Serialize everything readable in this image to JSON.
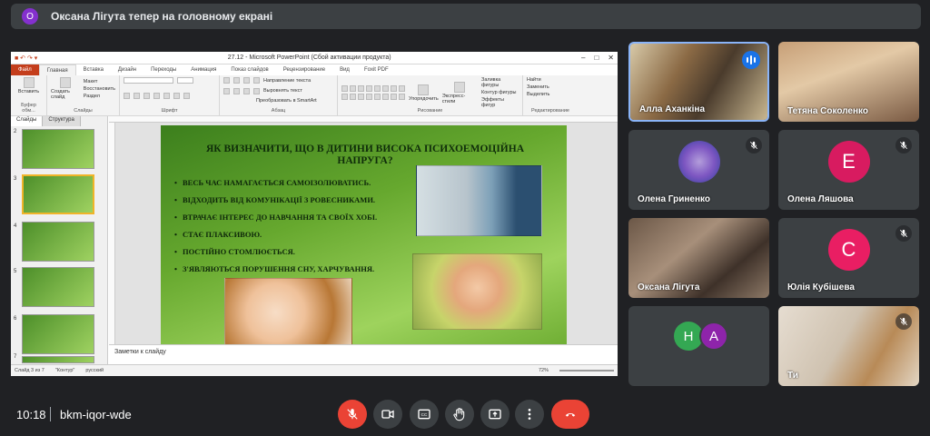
{
  "banner": {
    "avatar_letter": "О",
    "text": "Оксана Лігута тепер на головному екрані"
  },
  "powerpoint": {
    "window_title": "27.12 - Microsoft PowerPoint (Сбой активации продукта)",
    "tabs": [
      "Файл",
      "Главная",
      "Вставка",
      "Дизайн",
      "Переходы",
      "Анимация",
      "Показ слайдов",
      "Рецензирование",
      "Вид",
      "Foxit PDF"
    ],
    "active_tab": "Главная",
    "ribbon": {
      "clipboard_label": "Буфер обм...",
      "paste": "Вставить",
      "slides_label": "Слайды",
      "create_slide": "Создать слайд",
      "layout": "Макет",
      "reset": "Восстановить",
      "section": "Раздел",
      "font_label": "Шрифт",
      "paragraph_label": "Абзац",
      "text_direction": "Направление текста",
      "align_text": "Выровнять текст",
      "smartart": "Преобразовать в SmartArt",
      "drawing_label": "Рисование",
      "arrange": "Упорядочить",
      "quick_styles": "Экспресс-стили",
      "shape_fill": "Заливка фигуры",
      "shape_outline": "Контур фигуры",
      "shape_effects": "Эффекты фигур",
      "editing_label": "Редактирование",
      "find": "Найти",
      "replace": "Заменить",
      "select": "Выделить"
    },
    "panel_tabs": [
      "Слайды",
      "Структура"
    ],
    "thumb_numbers": [
      "2",
      "3",
      "4",
      "5",
      "6",
      "7"
    ],
    "slide": {
      "title": "ЯК ВИЗНАЧИТИ, ЩО В ДИТИНИ ВИСОКА ПСИХОЕМОЦІЙНА НАПРУГА?",
      "bullets": [
        "ВЕСЬ ЧАС НАМАГАЄТЬСЯ САМОІЗОЛЮВАТИСЬ.",
        "ВІДХОДИТЬ ВІД КОМУНІКАЦІЇ З РОВЕСНИКАМИ.",
        "ВТРАЧАЄ ІНТЕРЕС ДО НАВЧАННЯ ТА СВОЇХ ХОБІ.",
        "СТАЄ ПЛАКСИВОЮ.",
        "ПОСТІЙНО СТОМЛЮЄТЬСЯ.",
        "З'ЯВЛЯЮТЬСЯ ПОРУШЕННЯ СНУ, ХАРЧУВАННЯ."
      ]
    },
    "notes_placeholder": "Заметки к слайду",
    "status": {
      "slide_info": "Слайд 3 из 7",
      "theme": "\"Контур\"",
      "language": "русский",
      "zoom": "72%"
    }
  },
  "participants": [
    {
      "name": "Алла Аханкіна",
      "speaking": true
    },
    {
      "name": "Тетяна Соколенко"
    },
    {
      "name": "Олена Гриненко",
      "muted": true
    },
    {
      "name": "Олена Ляшова",
      "avatar_letter": "Е",
      "avatar_color": "#d81b60",
      "muted": true
    },
    {
      "name": "Оксана Лігута"
    },
    {
      "name": "Юлія Кубішева",
      "avatar_letter": "С",
      "avatar_color": "#e91e63",
      "muted": true
    },
    {
      "avatars": [
        {
          "letter": "Н",
          "color": "#34a853"
        },
        {
          "letter": "А",
          "color": "#8e24aa"
        }
      ]
    },
    {
      "name": "Ти",
      "muted": true
    }
  ],
  "bottom_bar": {
    "time": "10:18",
    "meeting_code": "bkm-iqor-wde"
  },
  "colors": {
    "background": "#202124",
    "tile": "#3c4043",
    "danger": "#ea4335",
    "accent": "#1a73e8"
  }
}
